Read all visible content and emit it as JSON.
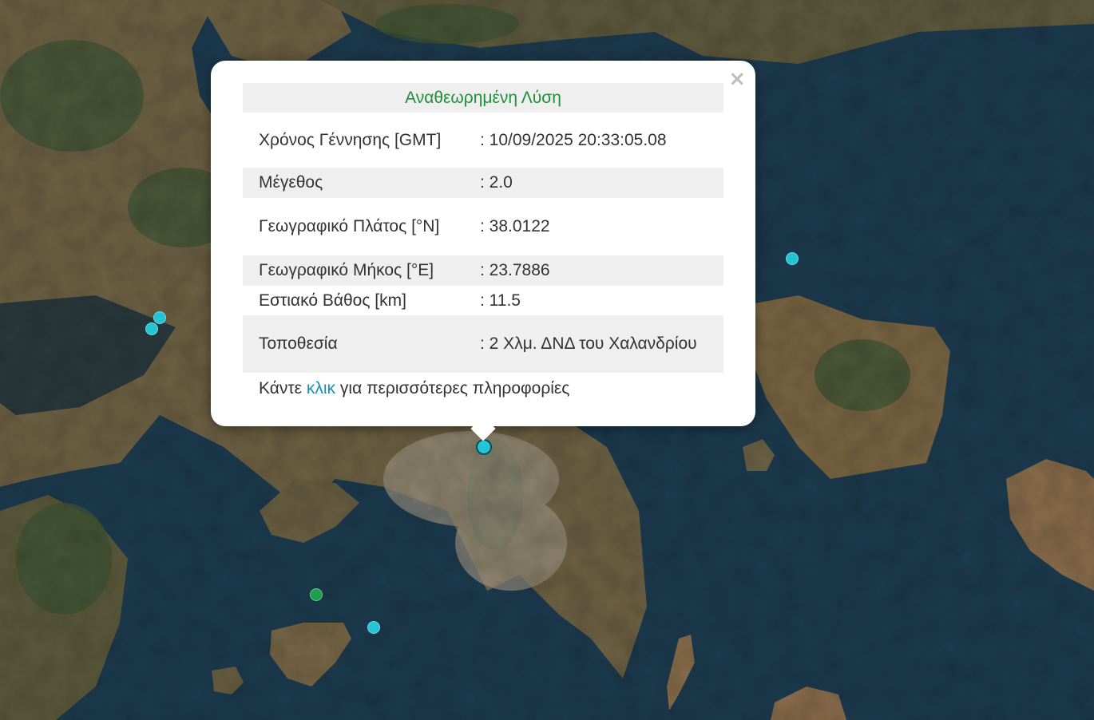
{
  "popup": {
    "title": "Αναθεωρημένη Λύση",
    "close_label": "×",
    "rows": [
      {
        "label": "Χρόνος Γέννησης [GMT]",
        "value": ": 10/09/2025 20:33:05.08"
      },
      {
        "label": "Μέγεθος",
        "value": ": 2.0"
      },
      {
        "label": "Γεωγραφικό Πλάτος [°N]",
        "value": ": 38.0122"
      },
      {
        "label": "Γεωγραφικό Μήκος [°E]",
        "value": ": 23.7886"
      },
      {
        "label": "Εστιακό Βάθος [km]",
        "value": ": 11.5"
      },
      {
        "label": "Τοποθεσία",
        "value": ": 2 Χλμ. ΔΝΔ του Χαλανδρίου"
      }
    ],
    "footer_pre": "Κάντε ",
    "footer_link": "κλικ",
    "footer_post": " για περισσότερες πληροφορίες"
  },
  "colors": {
    "title_green": "#1e8f3a",
    "link_blue": "#1a8fb5",
    "marker_cyan": "#22c4d6",
    "marker_green": "#1f9e4f",
    "sea": "#1b3a4e",
    "land": "#7a6a4a"
  },
  "markers": [
    {
      "name": "selected-quake-marker",
      "color": "cyan",
      "selected": true
    },
    {
      "name": "quake-marker",
      "color": "cyan"
    },
    {
      "name": "quake-marker",
      "color": "cyan"
    },
    {
      "name": "quake-marker",
      "color": "cyan"
    },
    {
      "name": "quake-marker",
      "color": "cyan"
    },
    {
      "name": "quake-marker",
      "color": "green"
    }
  ]
}
